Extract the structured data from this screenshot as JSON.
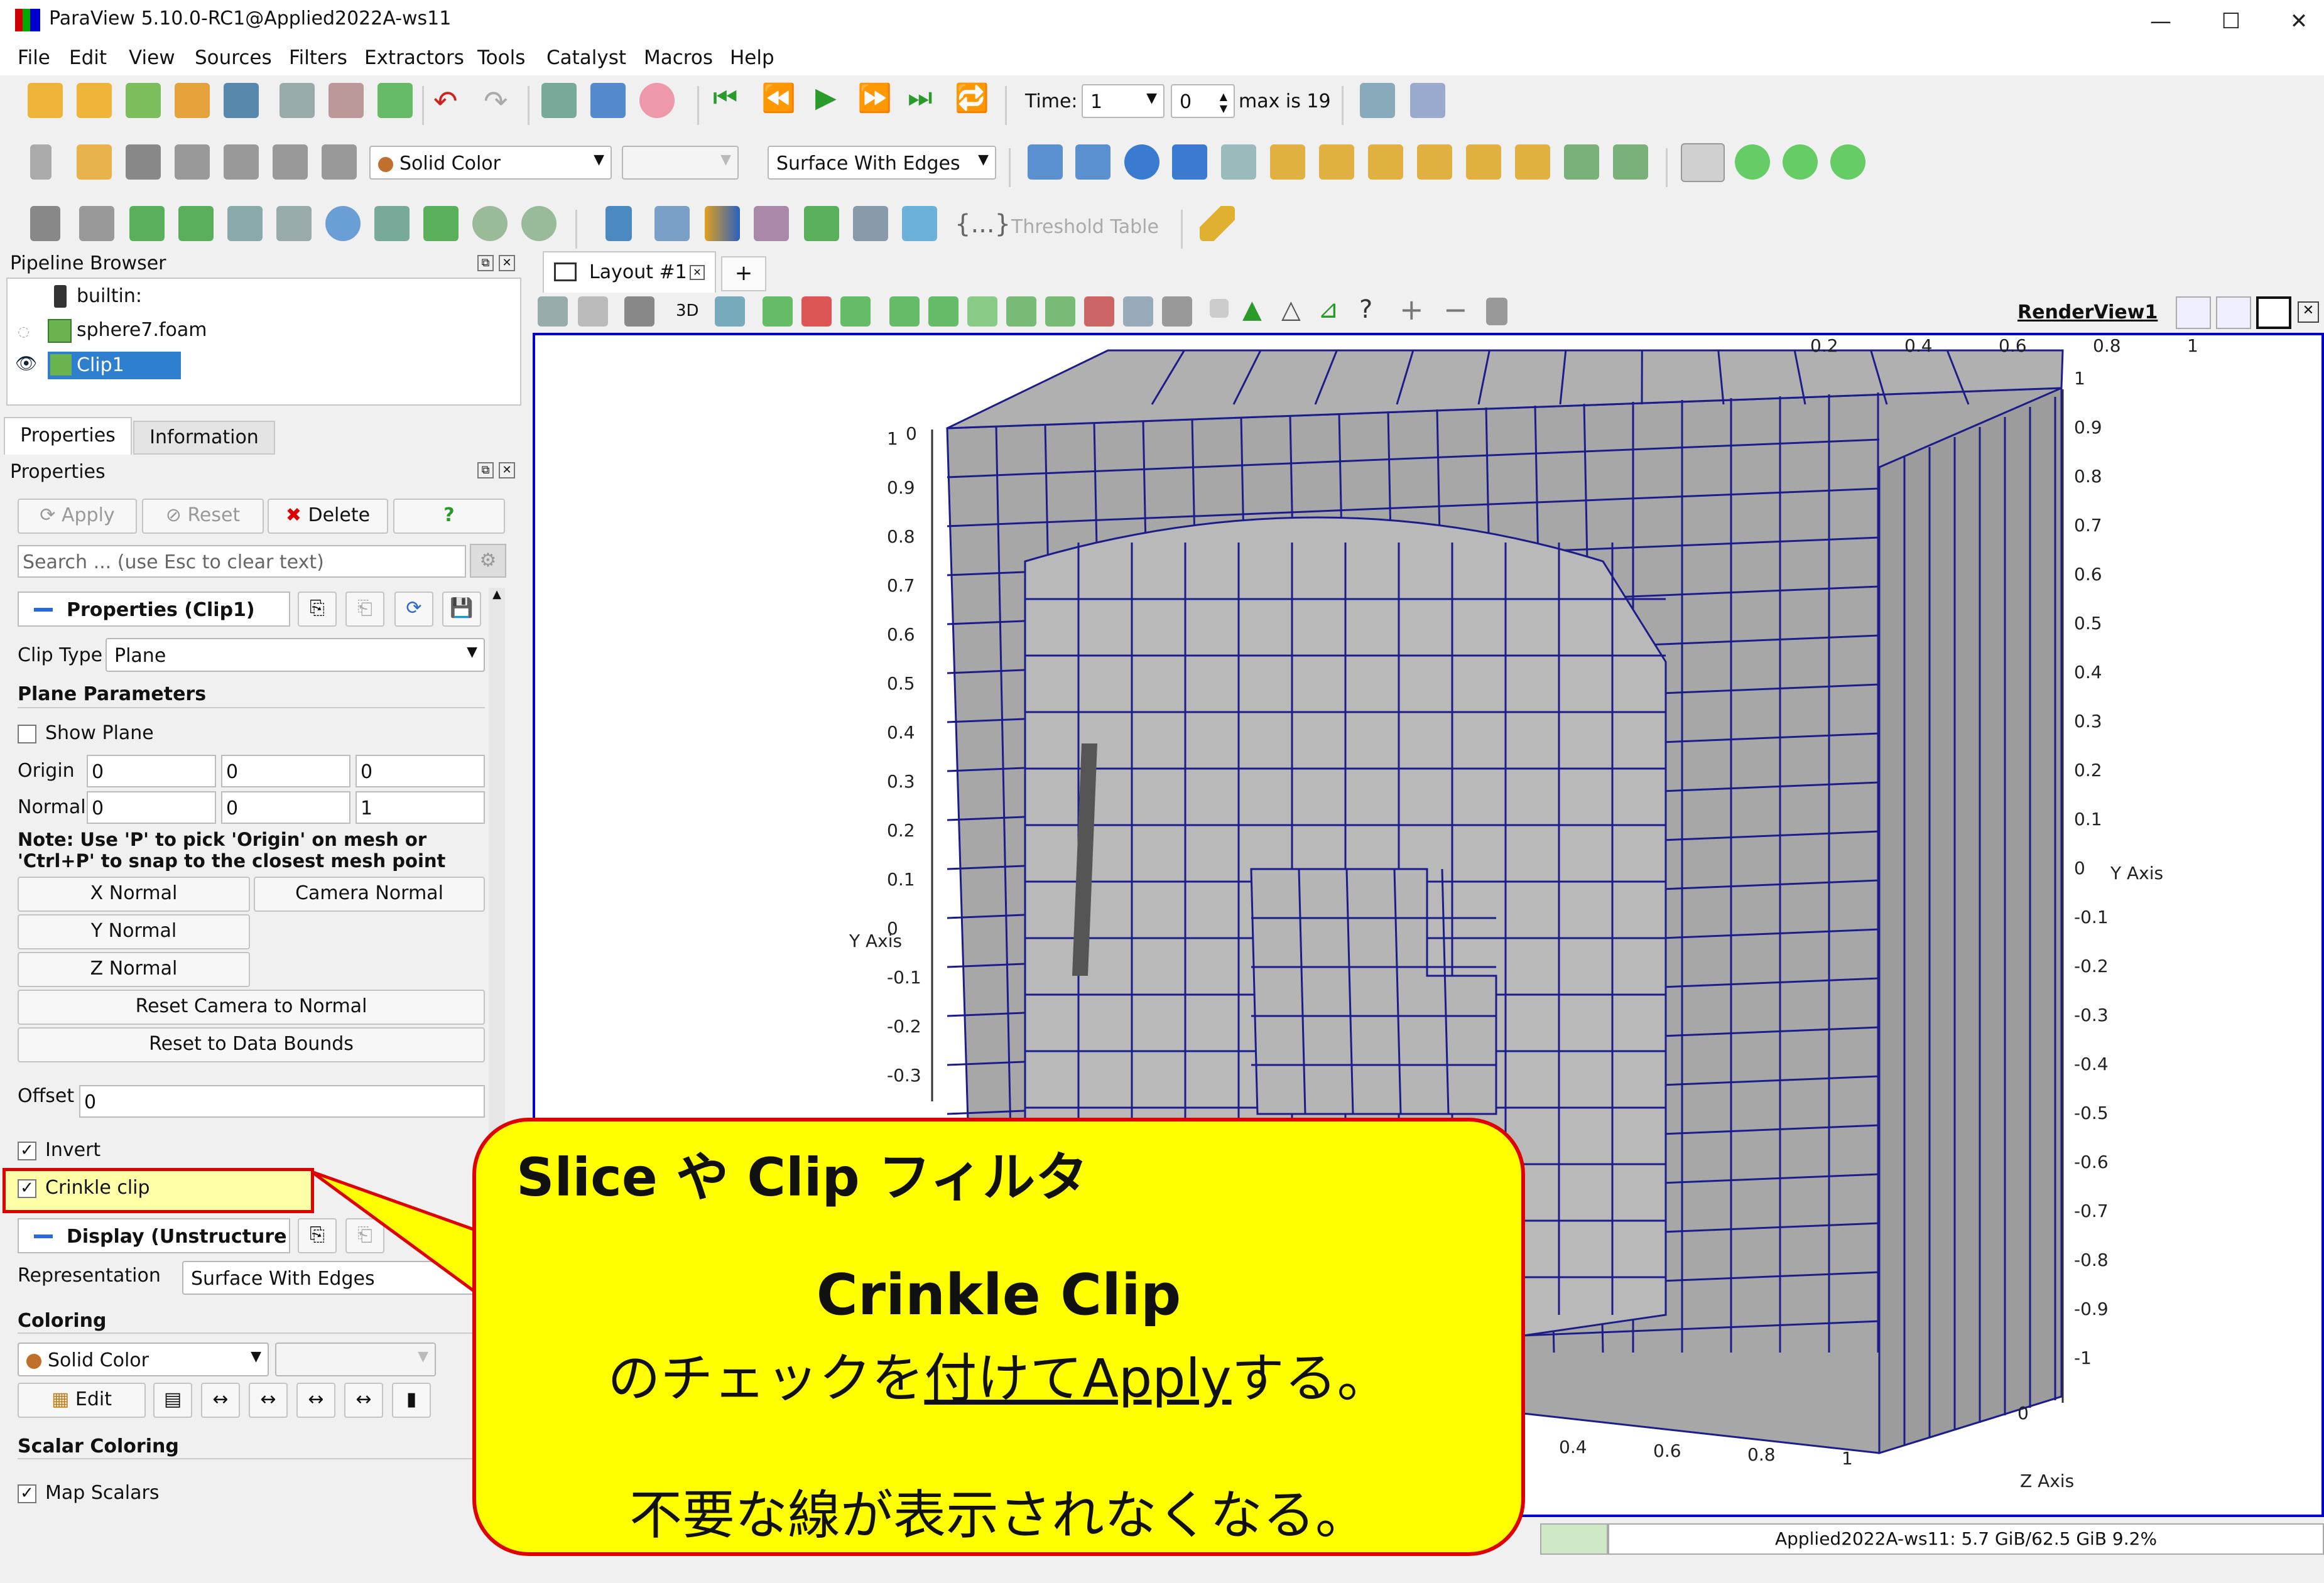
{
  "window": {
    "title": "ParaView 5.10.0-RC1@Applied2022A-ws11",
    "minimize": "—",
    "maximize": "☐",
    "close": "✕"
  },
  "menu": [
    "File",
    "Edit",
    "View",
    "Sources",
    "Filters",
    "Extractors",
    "Tools",
    "Catalyst",
    "Macros",
    "Help"
  ],
  "toolbar": {
    "time_label": "Time:",
    "time_value": "1",
    "time_index": "0",
    "time_max": "max is 19",
    "solid_color": "Solid Color",
    "representation": "Surface With Edges",
    "threshold_table": "Threshold Table"
  },
  "pipeline": {
    "title": "Pipeline Browser",
    "items": [
      "builtin:",
      "sphere7.foam",
      "Clip1"
    ]
  },
  "tabs": {
    "properties": "Properties",
    "information": "Information"
  },
  "properties": {
    "header": "Properties",
    "apply": "Apply",
    "reset": "Reset",
    "delete": "Delete",
    "help": "?",
    "search_placeholder": "Search ... (use Esc to clear text)",
    "section": "Properties (Clip1)",
    "clip_type_label": "Clip Type",
    "clip_type_value": "Plane",
    "plane_params": "Plane Parameters",
    "show_plane": "Show Plane",
    "origin_label": "Origin",
    "origin": [
      "0",
      "0",
      "0"
    ],
    "normal_label": "Normal",
    "normal": [
      "0",
      "0",
      "1"
    ],
    "note": "Note: Use 'P' to pick 'Origin' on mesh or 'Ctrl+P' to snap to the closest mesh point",
    "x_normal": "X Normal",
    "camera_normal": "Camera Normal",
    "y_normal": "Y Normal",
    "z_normal": "Z Normal",
    "reset_camera": "Reset Camera to Normal",
    "reset_bounds": "Reset to Data Bounds",
    "offset_label": "Offset",
    "offset_value": "0",
    "invert": "Invert",
    "crinkle": "Crinkle clip",
    "display_section": "Display (Unstructure",
    "representation_label": "Representation",
    "representation_value": "Surface With Edges",
    "coloring": "Coloring",
    "coloring_value": "Solid Color",
    "edit": "Edit",
    "scalar_coloring": "Scalar Coloring",
    "map_scalars": "Map Scalars"
  },
  "layout": {
    "tab": "Layout #1",
    "add": "+",
    "threed": "3D",
    "renderview": "RenderView1"
  },
  "axes": {
    "left_ticks": [
      "1",
      "0.9",
      "0.8",
      "0.7",
      "0.6",
      "0.5",
      "0.4",
      "0.3",
      "0.2",
      "0.1",
      "0",
      "-0.1",
      "-0.2",
      "-0.3"
    ],
    "left_title": "Y Axis",
    "left_zero": "0",
    "top_ticks": [
      "0.2",
      "0.4",
      "0.6",
      "0.8",
      "1"
    ],
    "right_ticks": [
      "1",
      "0.9",
      "0.8",
      "0.7",
      "0.6",
      "0.5",
      "0.4",
      "0.3",
      "0.2",
      "0.1",
      "0",
      "-0.1",
      "-0.2",
      "-0.3",
      "-0.4",
      "-0.5",
      "-0.6",
      "-0.7",
      "-0.8",
      "-0.9",
      "-1"
    ],
    "right_title": "Y Axis",
    "bottom_ticks": [
      "0.4",
      "0.6",
      "0.8",
      "1"
    ],
    "z_title": "Z Axis",
    "z_zero": "0"
  },
  "callout": {
    "title": "Slice や Clip フィルタ",
    "subtitle": "Crinkle Clip",
    "line1_pre": "のチェックを",
    "line1_u": "付けてApply",
    "line1_post": "する。",
    "line2": "不要な線が表示されなくなる。"
  },
  "status": {
    "memory": "Applied2022A-ws11: 5.7 GiB/62.5 GiB 9.2%"
  },
  "colors": {
    "accent": "#0000cc",
    "callout_fill": "#ffff00",
    "callout_border": "#e00000",
    "mesh": "#a8a8a8",
    "mesh_line": "#1c1c8a"
  }
}
